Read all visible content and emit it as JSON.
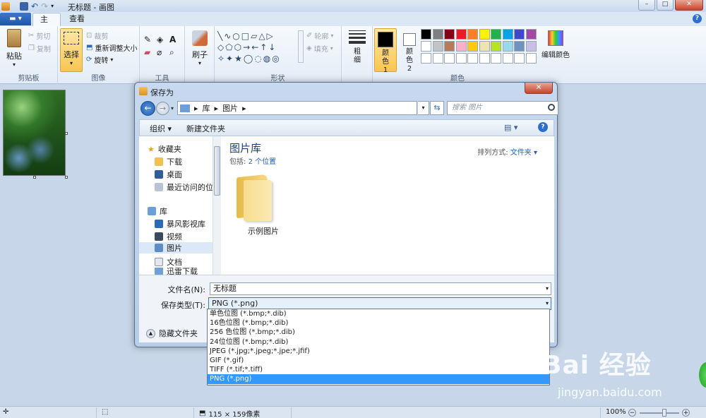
{
  "app": {
    "title": "无标题 - 画图",
    "menu_label": "▾"
  },
  "tabs": [
    {
      "label": "主页"
    },
    {
      "label": "查看"
    }
  ],
  "ribbon": {
    "clipboard": {
      "paste": "粘贴",
      "cut": "剪切",
      "copy": "复制",
      "group": "剪贴板"
    },
    "image": {
      "select": "选择",
      "crop": "裁剪",
      "resize": "重新调整大小",
      "rotate": "旋转",
      "group": "图像"
    },
    "tools": {
      "group": "工具"
    },
    "brushes": {
      "label": "刷子"
    },
    "shapes": {
      "outline": "轮廓",
      "fill": "填充",
      "group": "形状"
    },
    "size": {
      "label": "粗细"
    },
    "colors": {
      "color1": "颜色 1",
      "color2": "颜色 2",
      "edit": "编辑颜色",
      "group": "颜色",
      "palette_row1": [
        "#000000",
        "#7f7f7f",
        "#880015",
        "#ed1c24",
        "#ff7f27",
        "#fff200",
        "#22b14c",
        "#00a2e8",
        "#3f48cc",
        "#a349a4"
      ],
      "palette_row2": [
        "#ffffff",
        "#c3c3c3",
        "#b97a57",
        "#ffaec9",
        "#ffc90e",
        "#efe4b0",
        "#b5e61d",
        "#99d9ea",
        "#7092be",
        "#c8bfe7"
      ]
    }
  },
  "status": {
    "dimensions": "115 × 159像素",
    "zoom": "100%"
  },
  "dialog": {
    "title": "保存为",
    "address": [
      "库",
      "图片"
    ],
    "search_placeholder": "搜索 图片",
    "toolbar": {
      "organize": "组织 ▾",
      "new_folder": "新建文件夹"
    },
    "nav": {
      "favorites": "收藏夹",
      "items1": [
        "下载",
        "桌面",
        "最近访问的位置"
      ],
      "libraries": "库",
      "items2": [
        "暴风影视库",
        "视频",
        "图片",
        "文档",
        "迅雷下载"
      ]
    },
    "library_title": "图片库",
    "library_sub_prefix": "包括:",
    "library_sub_link": "2 个位置",
    "sort_label": "排列方式:",
    "sort_value": "文件夹 ▾",
    "folder_name": "示例图片",
    "filename_label": "文件名(N):",
    "filename_value": "无标题",
    "filetype_label": "保存类型(T):",
    "filetype_value": "PNG (*.png)",
    "hide_folders": "隐藏文件夹",
    "filetype_options": [
      "单色位图 (*.bmp;*.dib)",
      "16色位图 (*.bmp;*.dib)",
      "256 色位图 (*.bmp;*.dib)",
      "24位位图 (*.bmp;*.dib)",
      "JPEG (*.jpg;*.jpeg;*.jpe;*.jfif)",
      "GIF (*.gif)",
      "TIFF (*.tif;*.tiff)",
      "PNG (*.png)"
    ]
  },
  "watermark": {
    "logo": "Bai 经验",
    "url": "jingyan.baidu.com"
  }
}
